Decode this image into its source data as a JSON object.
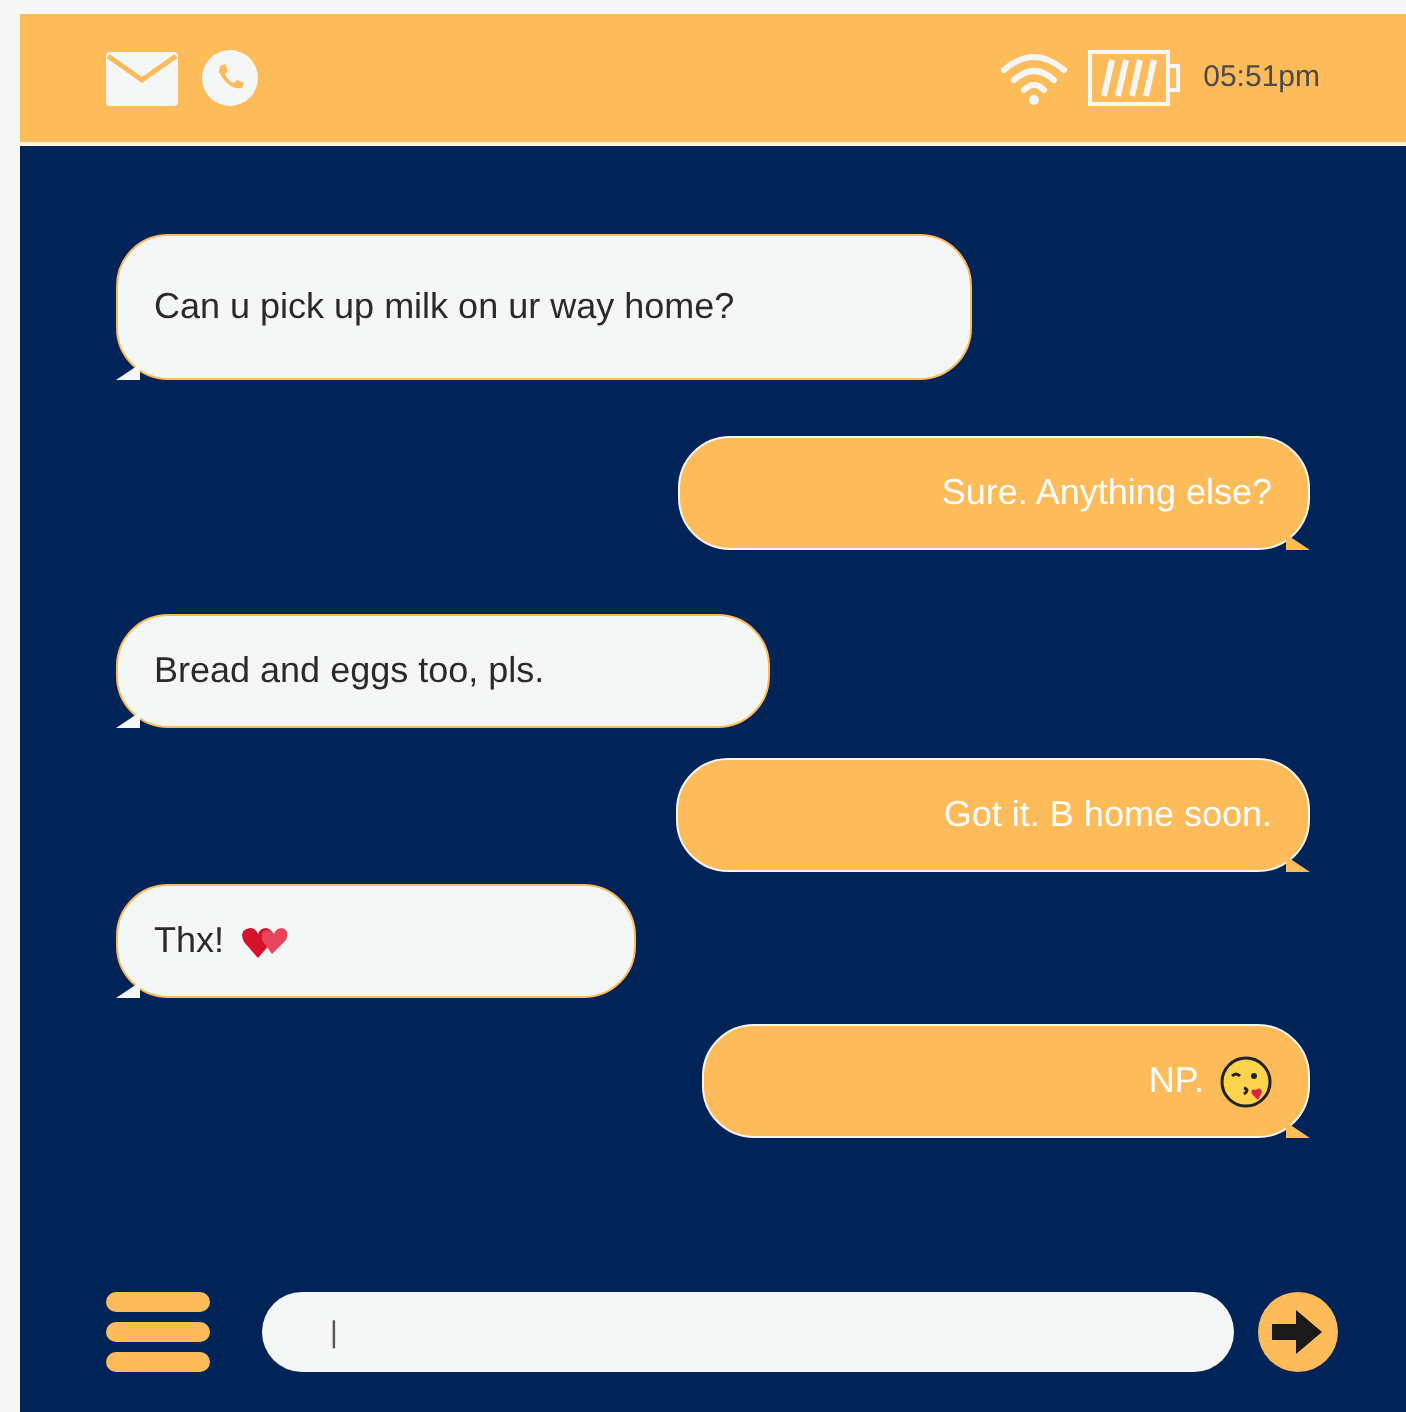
{
  "status_bar": {
    "time": "05:51pm"
  },
  "messages": [
    {
      "text": "Can u pick up milk on ur way home?",
      "kind": "incoming"
    },
    {
      "text": "Sure. Anything else?",
      "kind": "outgoing"
    },
    {
      "text": "Bread and eggs too, pls.",
      "kind": "incoming"
    },
    {
      "text": "Got it. B home soon.",
      "kind": "outgoing"
    },
    {
      "text": "Thx!",
      "kind": "incoming-hearts"
    },
    {
      "text": "NP.",
      "kind": "outgoing-kiss"
    }
  ],
  "composer": {
    "placeholder": "|"
  }
}
